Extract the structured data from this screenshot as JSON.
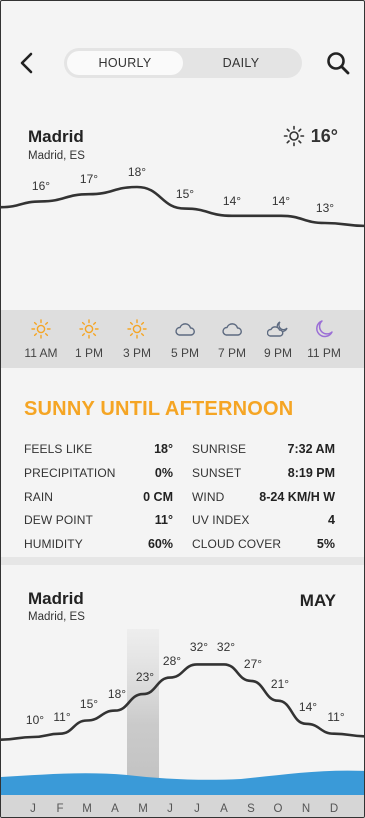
{
  "header": {
    "tabs": [
      {
        "label": "HOURLY",
        "active": true
      },
      {
        "label": "DAILY",
        "active": false
      }
    ]
  },
  "hourly": {
    "location": {
      "city": "Madrid",
      "region": "Madrid, ES"
    },
    "current": {
      "temp": "16°",
      "icon": "sun-icon"
    },
    "chart_data": {
      "type": "line",
      "labels": [
        "16°",
        "17°",
        "18°",
        "15°",
        "14°",
        "14°",
        "13°"
      ],
      "values": [
        16,
        17,
        18,
        15,
        14,
        14,
        13
      ]
    },
    "hours": [
      {
        "time": "11 AM",
        "icon": "sun-icon"
      },
      {
        "time": "1 PM",
        "icon": "sun-icon"
      },
      {
        "time": "3 PM",
        "icon": "sun-icon"
      },
      {
        "time": "5 PM",
        "icon": "cloud-icon"
      },
      {
        "time": "7 PM",
        "icon": "cloud-icon"
      },
      {
        "time": "9 PM",
        "icon": "partly-cloudy-night-icon"
      },
      {
        "time": "11 PM",
        "icon": "moon-icon"
      }
    ],
    "summary": "SUNNY UNTIL AFTERNOON",
    "stats_left": [
      {
        "label": "FEELS LIKE",
        "value": "18°"
      },
      {
        "label": "PRECIPITATION",
        "value": "0%"
      },
      {
        "label": "RAIN",
        "value": "0 CM"
      },
      {
        "label": "DEW POINT",
        "value": "11°"
      },
      {
        "label": "HUMIDITY",
        "value": "60%"
      }
    ],
    "stats_right": [
      {
        "label": "SUNRISE",
        "value": "7:32 AM"
      },
      {
        "label": "SUNSET",
        "value": "8:19 PM"
      },
      {
        "label": "WIND",
        "value": "8-24 KM/H W"
      },
      {
        "label": "UV INDEX",
        "value": "4"
      },
      {
        "label": "CLOUD COVER",
        "value": "5%"
      }
    ]
  },
  "yearly": {
    "location": {
      "city": "Madrid",
      "region": "Madrid, ES"
    },
    "month": "MAY",
    "months": [
      "J",
      "F",
      "M",
      "A",
      "M",
      "J",
      "J",
      "A",
      "S",
      "O",
      "N",
      "D"
    ],
    "selected_month_index": 4,
    "chart_data": {
      "type": "line",
      "categories": [
        "J",
        "F",
        "M",
        "A",
        "M",
        "J",
        "J",
        "A",
        "S",
        "O",
        "N",
        "D"
      ],
      "labels": [
        "10°",
        "11°",
        "15°",
        "18°",
        "23°",
        "28°",
        "32°",
        "32°",
        "27°",
        "21°",
        "14°",
        "11°"
      ],
      "values": [
        10,
        11,
        15,
        18,
        23,
        28,
        32,
        32,
        27,
        21,
        14,
        11
      ]
    }
  },
  "colors": {
    "accent": "#f5a524",
    "sun": "#f5a524",
    "moon": "#9b6fd6",
    "cloud": "#5d6a80",
    "rain_band": "#3a9ad8",
    "selected_band": "#c9c9c9"
  }
}
